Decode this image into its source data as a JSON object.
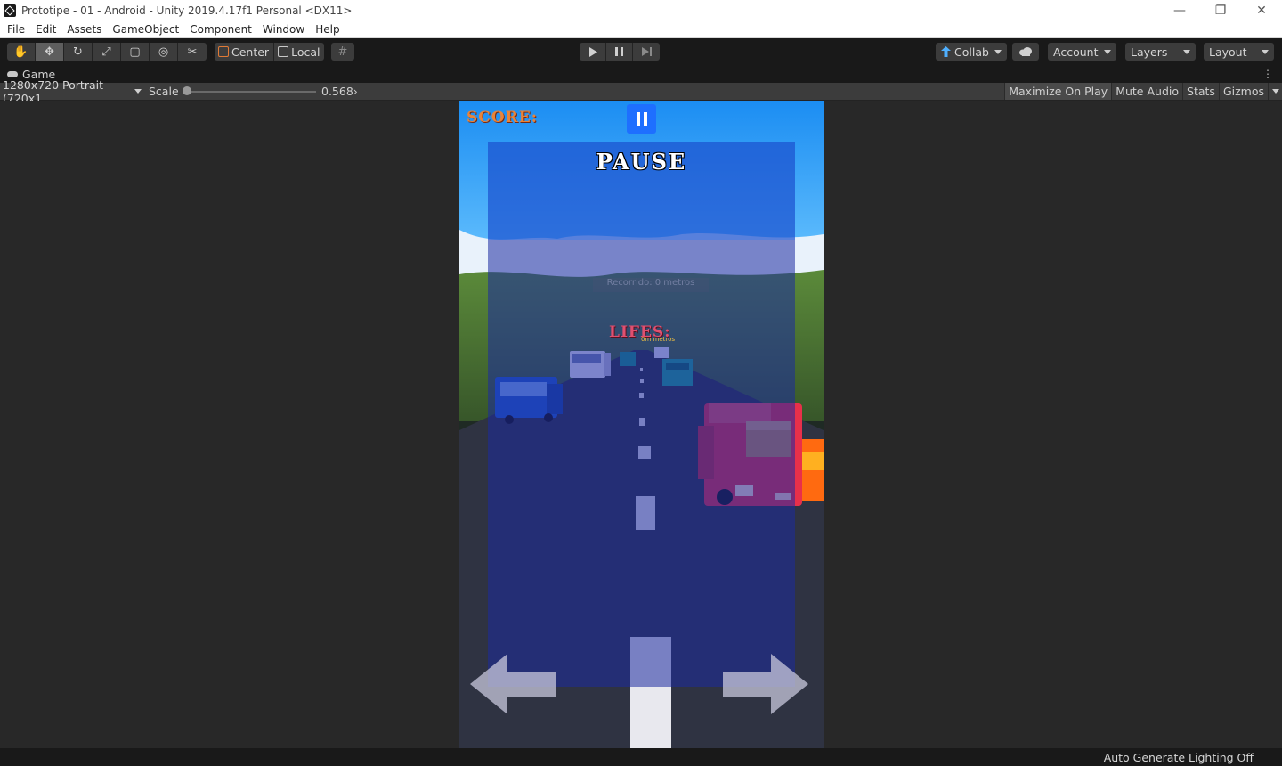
{
  "window": {
    "title": "Prototipe - 01 - Android - Unity 2019.4.17f1 Personal <DX11>",
    "controls": [
      "—",
      "❐",
      "✕"
    ]
  },
  "menu": [
    "File",
    "Edit",
    "Assets",
    "GameObject",
    "Component",
    "Window",
    "Help"
  ],
  "toolbar": {
    "tools": [
      {
        "name": "hand-tool",
        "glyph": "✋"
      },
      {
        "name": "move-tool",
        "glyph": "✥"
      },
      {
        "name": "rotate-tool",
        "glyph": "↻"
      },
      {
        "name": "scale-tool",
        "glyph": "⤢"
      },
      {
        "name": "rect-tool",
        "glyph": "▢"
      },
      {
        "name": "transform-tool",
        "glyph": "◎"
      },
      {
        "name": "custom-tool",
        "glyph": "✂"
      }
    ],
    "pivot_mode": "Center",
    "pivot_rotation": "Local",
    "snap_glyph": "#",
    "collab_label": "Collab",
    "account_label": "Account",
    "layers_label": "Layers",
    "layout_label": "Layout"
  },
  "game_tab": {
    "label": "Game",
    "menu_glyph": "⋮"
  },
  "game_toolbar": {
    "resolution": "1280x720 Portrait (720x1",
    "scale_label": "Scale",
    "scale_value": "0.568›",
    "scale_fraction": 0.0,
    "maximize_on_play": "Maximize On Play",
    "mute_audio": "Mute Audio",
    "stats": "Stats",
    "gizmos": "Gizmos"
  },
  "game": {
    "score_label": "SCORE:",
    "pause_title": "PAUSE",
    "lifes_label": "LIFES:",
    "faded_text": "Recorrido: 0 metros",
    "distance_small": "0m metros",
    "colors": {
      "sky": "#1a8cf0",
      "pause_overlay": "#1c2aa0",
      "road": "#2c3060",
      "score_text": "#e8843a",
      "lifes_text": "#e05070",
      "pause_button": "#1e6fff"
    }
  },
  "status": {
    "lighting": "Auto Generate Lighting Off"
  }
}
